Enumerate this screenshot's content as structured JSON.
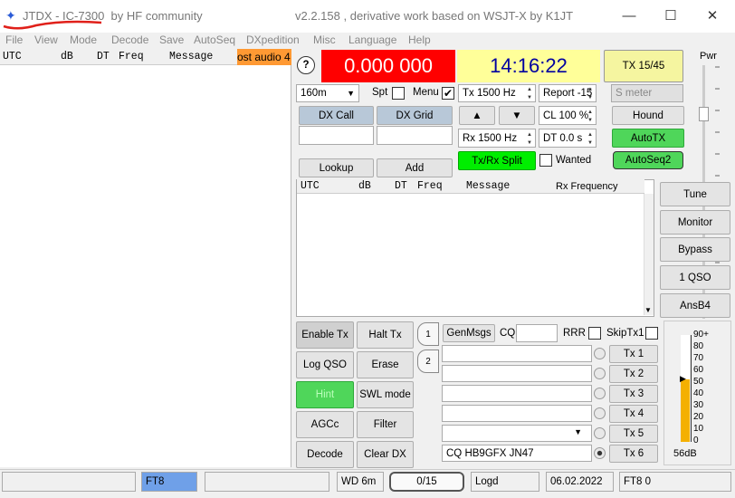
{
  "title": {
    "app": "JTDX - IC-7300",
    "community": "by HF community",
    "version": "v2.2.158 , derivative work based on WSJT-X by K1JT"
  },
  "window_controls": {
    "minimize": "—",
    "maximize": "☐",
    "close": "✕"
  },
  "menu": [
    "File",
    "View",
    "Mode",
    "Decode",
    "Save",
    "AutoSeq",
    "DXpedition",
    "Misc",
    "Language",
    "Help"
  ],
  "left_pane": {
    "headers": {
      "utc": "UTC",
      "db": "dB",
      "dt": "DT",
      "freq": "Freq",
      "message": "Message"
    },
    "tab": "ost audio 4"
  },
  "help_button": "?",
  "frequency": "0.000 000",
  "clock": "14:16:22",
  "tx_period": "TX 15/45",
  "pwr_label": "Pwr",
  "band": "160m",
  "spt_label": "Spt",
  "menu_label": "Menu",
  "tx_freq": "Tx  1500  Hz",
  "report": "Report -15",
  "smeter": "S meter",
  "dx_call_label": "DX Call",
  "dx_grid_label": "DX Grid",
  "cl": "CL  100 %",
  "hound": "Hound",
  "rx_freq": "Rx  1500  Hz",
  "dt": "DT 0.0 s",
  "autotx": "AutoTX",
  "txrx_split": "Tx/Rx Split",
  "wanted": "Wanted",
  "autoseq2": "AutoSeq2",
  "lookup": "Lookup",
  "add": "Add",
  "up_arrow": "▲",
  "down_arrow": "▼",
  "rx_pane": {
    "headers": {
      "utc": "UTC",
      "db": "dB",
      "dt": "DT",
      "freq": "Freq",
      "message": "Message"
    },
    "rx_freq_label": "Rx Frequency"
  },
  "right_buttons": [
    "Tune",
    "Monitor",
    "Bypass",
    "1 QSO",
    "AnsB4"
  ],
  "ctrl_buttons": [
    "Enable Tx",
    "Halt Tx",
    "Log QSO",
    "Erase",
    "Hint",
    "SWL mode",
    "AGCc",
    "Filter",
    "Decode",
    "Clear DX"
  ],
  "tabs": {
    "tab1": "1",
    "tab2": "2"
  },
  "genmsgs": "GenMsgs",
  "cq_label": "CQ",
  "rrr_label": "RRR",
  "skiptx1_label": "SkipTx1",
  "tx_buttons": [
    "Tx 1",
    "Tx 2",
    "Tx 3",
    "Tx 4",
    "Tx 5",
    "Tx 6"
  ],
  "tx6_message": "CQ HB9GFX JN47",
  "meter": {
    "ticks": [
      "90+",
      "80",
      "70",
      "60",
      "50",
      "40",
      "30",
      "20",
      "10",
      "0"
    ],
    "level_db": 56,
    "level_label": "56dB"
  },
  "status": {
    "mode": "FT8",
    "wd": "WD 6m",
    "progress": "0/15",
    "logd": "Logd",
    "date": "06.02.2022",
    "mode_right": "FT8  0"
  },
  "colors": {
    "freq_bg": "#ff0000",
    "freq_fg": "#ffffff",
    "clock_bg": "#ffff99",
    "clock_fg": "#0000a0",
    "green": "#4fd65a",
    "tab_orange": "#ff9933",
    "mode_blue": "#6fa0e8"
  }
}
